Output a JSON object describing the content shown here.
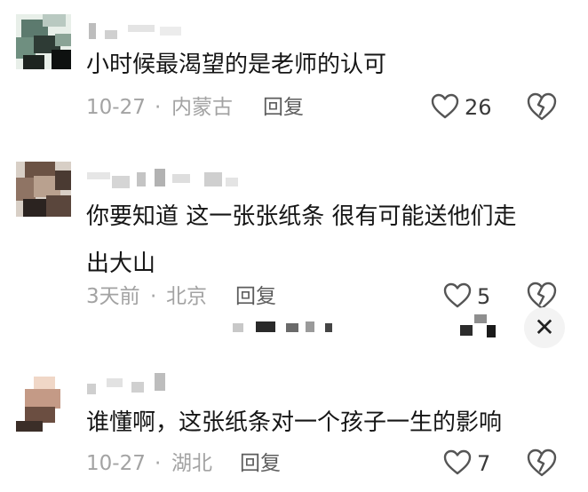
{
  "comments": [
    {
      "text": "小时候最渴望的是老师的认可",
      "date": "10-27",
      "location": "内蒙古",
      "reply_label": "回复",
      "likes": "26"
    },
    {
      "text": "你要知道 这一张张纸条 很有可能送他们走\n出大山",
      "date": "3天前",
      "location": "北京",
      "reply_label": "回复",
      "likes": "5"
    },
    {
      "text": "谁懂啊，这张纸条对一个孩子一生的影响",
      "date": "10-27",
      "location": "湖北",
      "reply_label": "回复",
      "likes": "7"
    }
  ],
  "meta_separator": "·",
  "close_glyph": "✕",
  "colors": {
    "text": "#161616",
    "meta": "#a3a3a3",
    "reply": "#5d5d5d",
    "icon": "#555555"
  },
  "icons": {
    "like": "heart-outline-icon",
    "dislike": "broken-heart-icon",
    "close": "close-icon"
  }
}
